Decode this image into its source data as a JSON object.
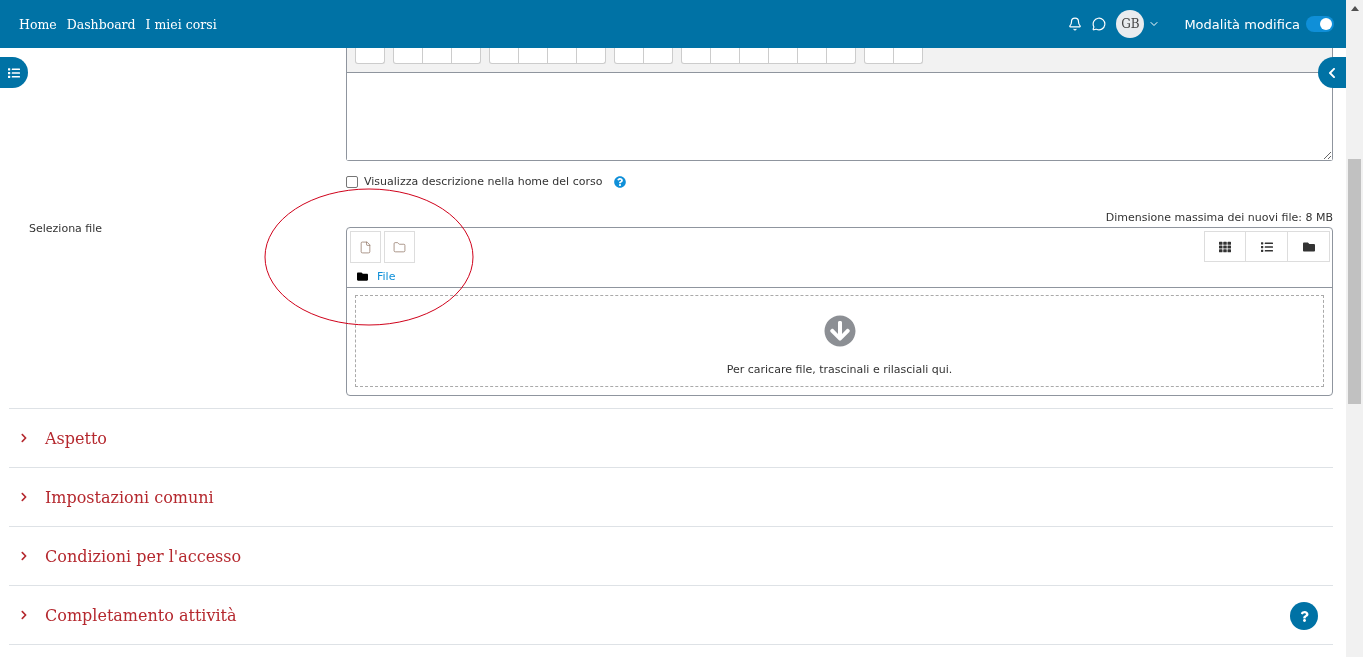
{
  "navbar": {
    "links": [
      "Home",
      "Dashboard",
      "I miei corsi"
    ],
    "avatar": "GB",
    "edit_mode": {
      "label": "Modalità modifica",
      "on": true
    }
  },
  "description_option": {
    "label": "Visualizza descrizione nella home del corso",
    "checked": false
  },
  "file_field": {
    "label": "Seleziona file",
    "max_size": "Dimensione massima dei nuovi file: 8 MB",
    "path": "File",
    "dropzone": "Per caricare file, trascinali e rilasciali qui."
  },
  "sections": [
    {
      "title": "Aspetto",
      "expanded": false
    },
    {
      "title": "Impostazioni comuni",
      "expanded": false
    },
    {
      "title": "Condizioni per l'accesso",
      "expanded": false
    },
    {
      "title": "Completamento attività",
      "expanded": false
    }
  ]
}
